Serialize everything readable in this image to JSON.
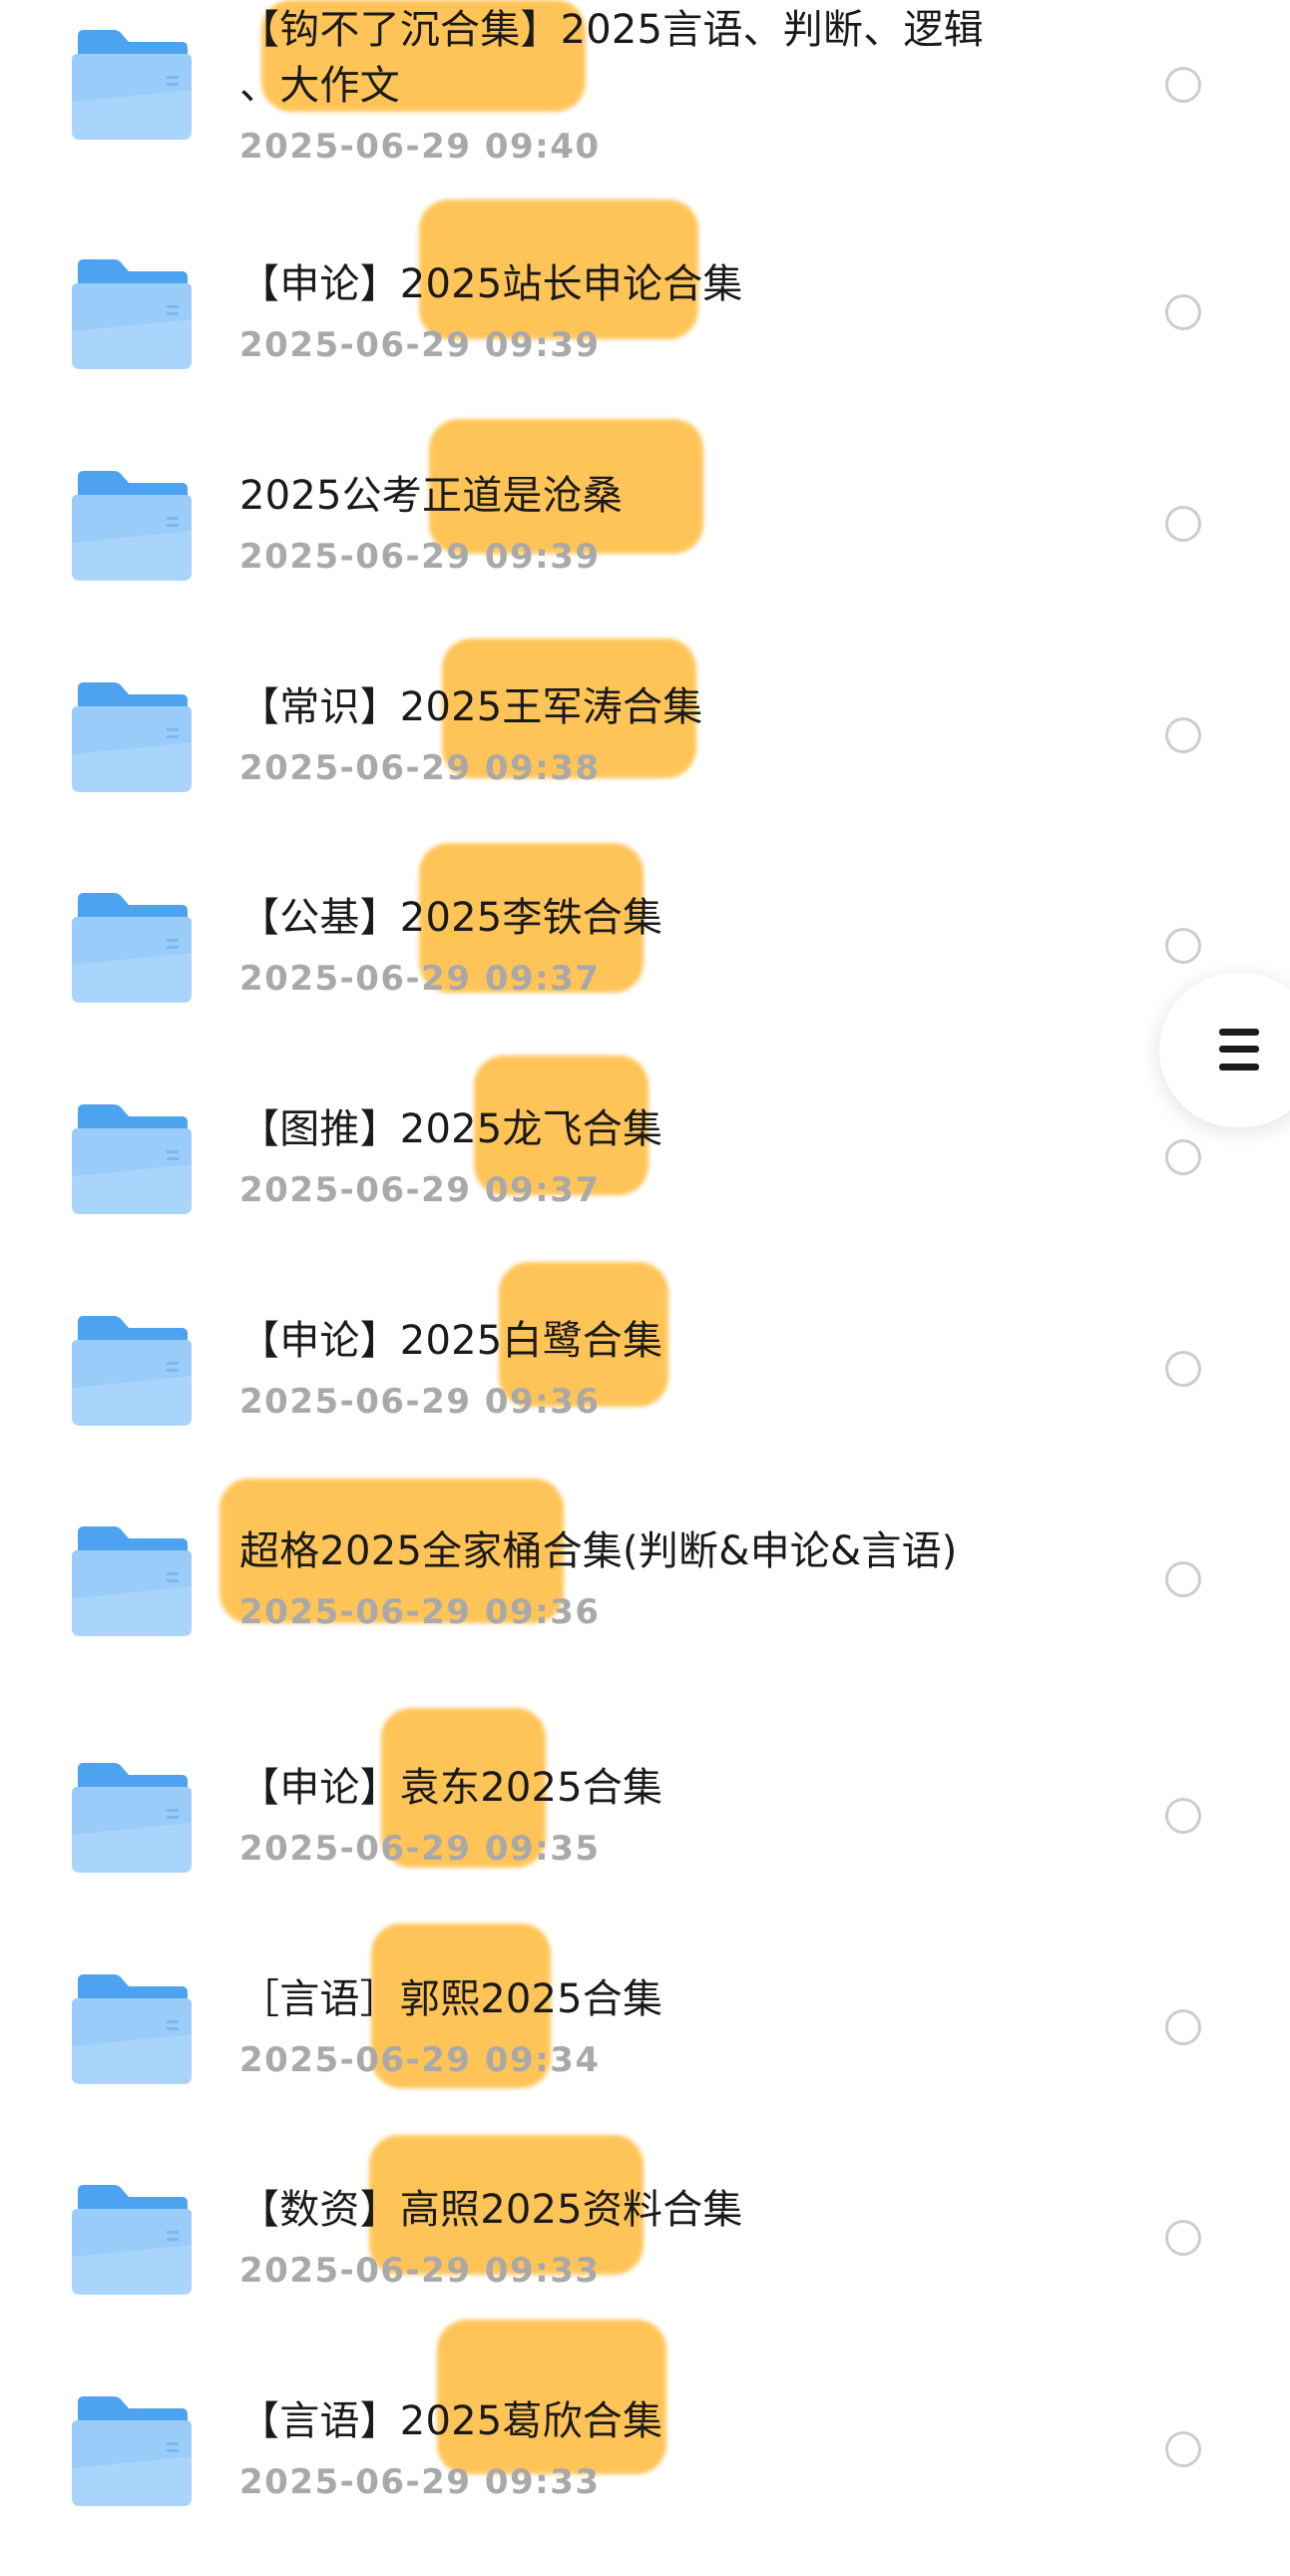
{
  "files": [
    {
      "name": "【钩不了沉合集】2025言语、判断、逻辑\n、大作文",
      "date": "2025-06-29 09:40"
    },
    {
      "name": "【申论】2025站长申论合集",
      "date": "2025-06-29 09:39"
    },
    {
      "name": "2025公考正道是沧桑",
      "date": "2025-06-29 09:39"
    },
    {
      "name": "【常识】2025王军涛合集",
      "date": "2025-06-29 09:38"
    },
    {
      "name": "【公基】2025李铁合集",
      "date": "2025-06-29 09:37"
    },
    {
      "name": "【图推】2025龙飞合集",
      "date": "2025-06-29 09:37"
    },
    {
      "name": "【申论】2025白鹭合集",
      "date": "2025-06-29 09:36"
    },
    {
      "name": "超格2025全家桶合集(判断&申论&言语)",
      "date": "2025-06-29 09:36"
    },
    {
      "name": "【申论】袁东2025合集",
      "date": "2025-06-29 09:35"
    },
    {
      "name": "［言语］郭熙2025合集",
      "date": "2025-06-29 09:34"
    },
    {
      "name": "【数资】高照2025资料合集",
      "date": "2025-06-29 09:33"
    },
    {
      "name": "【言语】2025葛欣合集",
      "date": "2025-06-29 09:33"
    }
  ],
  "icons": {
    "folder": "folder-icon",
    "select": "radio-circle-icon",
    "menu": "menu-icon"
  },
  "colors": {
    "folder_back": "#4ea3f0",
    "folder_front": "#a9d4fb",
    "highlight": "#ffb833",
    "date_text": "#a9a9a9",
    "name_text": "#1a1a1a"
  }
}
